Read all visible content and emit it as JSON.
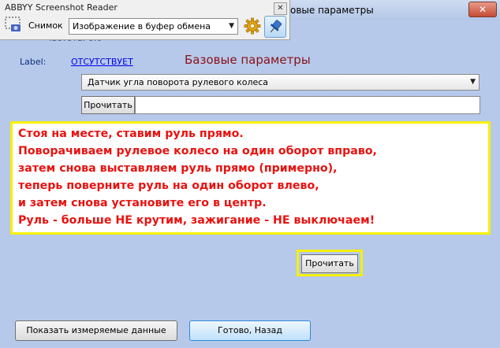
{
  "window": {
    "title": "овые параметры",
    "close_glyph": "✕",
    "faded_field": "Частота: 0.0",
    "logo": "ВАЗ"
  },
  "label_row": {
    "caption": "Label:",
    "link": "ОТСУТСТВУЕТ"
  },
  "heading": "Базовые параметры",
  "sensor_select": {
    "value": "Датчик угла поворота рулевого колеса"
  },
  "read_button_top": "Прочитать",
  "result_field": {
    "value": ""
  },
  "instructions": [
    "Стоя на месте, ставим руль прямо.",
    "Поворачиваем рулевое колесо на один оборот вправо,",
    "затем снова выставляем руль прямо (примерно),",
    "теперь поверните руль на один оборот влево,",
    "и затем снова установите его в центр.",
    "Руль - больше НЕ крутим, зажигание - НЕ выключаем!"
  ],
  "read_button_bottom": "Прочитать",
  "footer": {
    "show_data": "Показать измеряемые данные",
    "done_back": "Готово, Назад"
  },
  "overlay": {
    "title": "ABBYY Screenshot Reader",
    "close_glyph": "✕",
    "snapshot_label": "Снимок",
    "destination_value": "Изображение в буфер обмена"
  },
  "colors": {
    "accent_text": "#e8120f",
    "highlight": "#f6f000",
    "heading": "#8a1118",
    "window_bg": "#b6c9ea"
  }
}
